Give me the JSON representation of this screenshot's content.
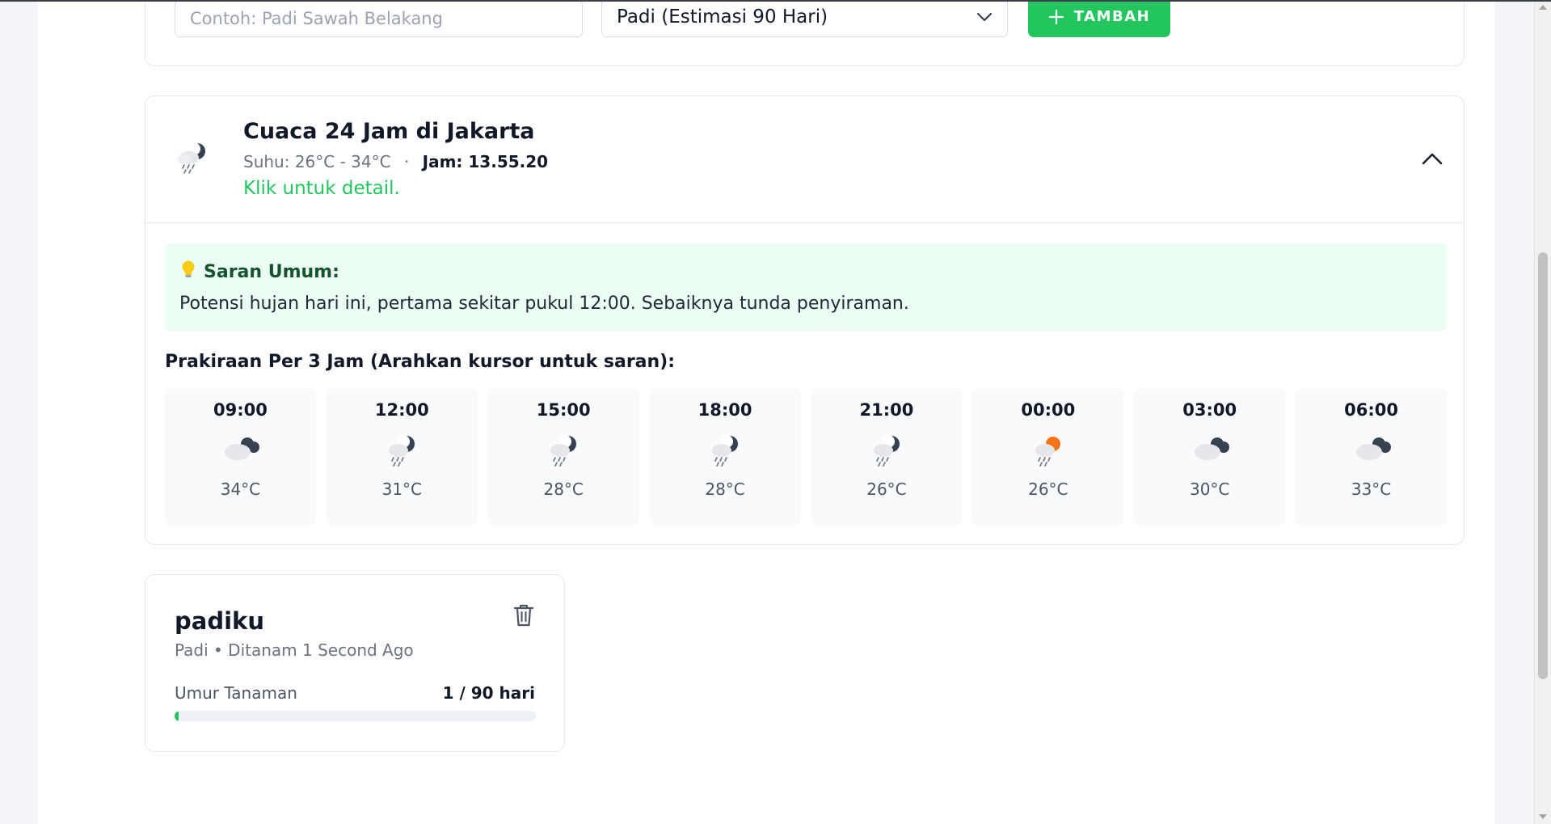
{
  "form": {
    "name_placeholder": "Contoh: Padi Sawah Belakang",
    "crop_select_value": "Padi (Estimasi 90 Hari)",
    "add_button_label": "TAMBAH"
  },
  "weather": {
    "title": "Cuaca 24 Jam di Jakarta",
    "temp_range": "Suhu: 26°C - 34°C",
    "separator": "·",
    "time_label": "Jam: 13.55.20",
    "detail_link": "Klik untuk detail.",
    "header_icon": "rain-cloud-moon-icon",
    "advice": {
      "title": "Saran Umum:",
      "icon": "lightbulb-icon",
      "text": "Potensi hujan hari ini, pertama sekitar pukul 12:00. Sebaiknya tunda penyiraman."
    },
    "forecast_title": "Prakiraan Per 3 Jam (Arahkan kursor untuk saran):",
    "forecast": [
      {
        "time": "09:00",
        "temp": "34°C",
        "icon": "cloudy-moon-icon"
      },
      {
        "time": "12:00",
        "temp": "31°C",
        "icon": "rain-moon-icon"
      },
      {
        "time": "15:00",
        "temp": "28°C",
        "icon": "rain-moon-icon"
      },
      {
        "time": "18:00",
        "temp": "28°C",
        "icon": "rain-moon-icon"
      },
      {
        "time": "21:00",
        "temp": "26°C",
        "icon": "rain-moon-icon"
      },
      {
        "time": "00:00",
        "temp": "26°C",
        "icon": "rain-sun-icon"
      },
      {
        "time": "03:00",
        "temp": "30°C",
        "icon": "cloudy-moon-icon"
      },
      {
        "time": "06:00",
        "temp": "33°C",
        "icon": "cloudy-moon-icon"
      }
    ]
  },
  "plant": {
    "name": "padiku",
    "meta": "Padi • Ditanam 1 Second Ago",
    "age_label": "Umur Tanaman",
    "age_value": "1 / 90 hari",
    "age_progress": 0.011
  },
  "colors": {
    "accent": "#22c55e",
    "advice_bg": "#ecfdf3",
    "sun": "#f97316"
  }
}
